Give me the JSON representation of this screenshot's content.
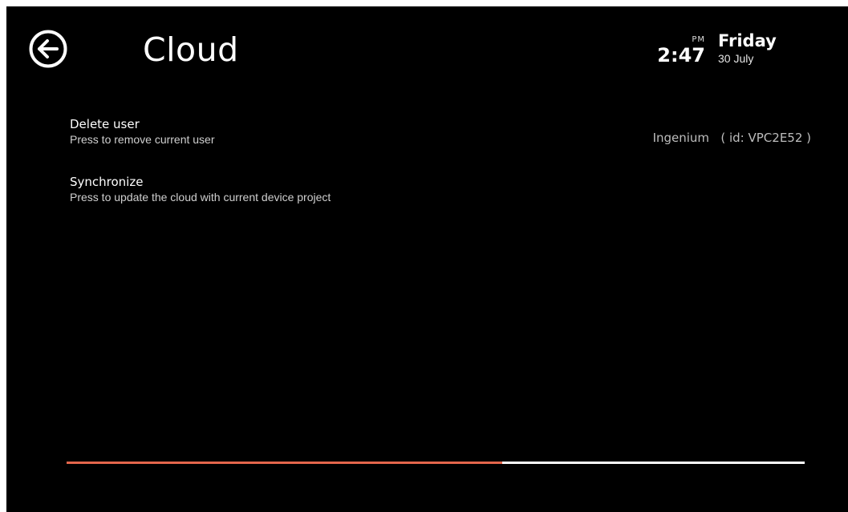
{
  "header": {
    "title": "Cloud",
    "back_icon": "arrow-left-circle-icon",
    "clock": {
      "ampm": "PM",
      "time": "2:47"
    },
    "date": {
      "day": "Friday",
      "day_month": "30 July"
    }
  },
  "menu": {
    "items": [
      {
        "title": "Delete user",
        "subtitle": "Press to remove current user"
      },
      {
        "title": "Synchronize",
        "subtitle": "Press to update the cloud with current device project"
      }
    ]
  },
  "account": {
    "name": "Ingenium",
    "id_label": "( id: VPC2E52 )"
  },
  "progress": {
    "fraction": 0.59,
    "fill_color": "#e4664c",
    "track_color": "#ffffff"
  },
  "colors": {
    "background": "#000000",
    "text": "#ffffff",
    "accent": "#e4664c"
  }
}
